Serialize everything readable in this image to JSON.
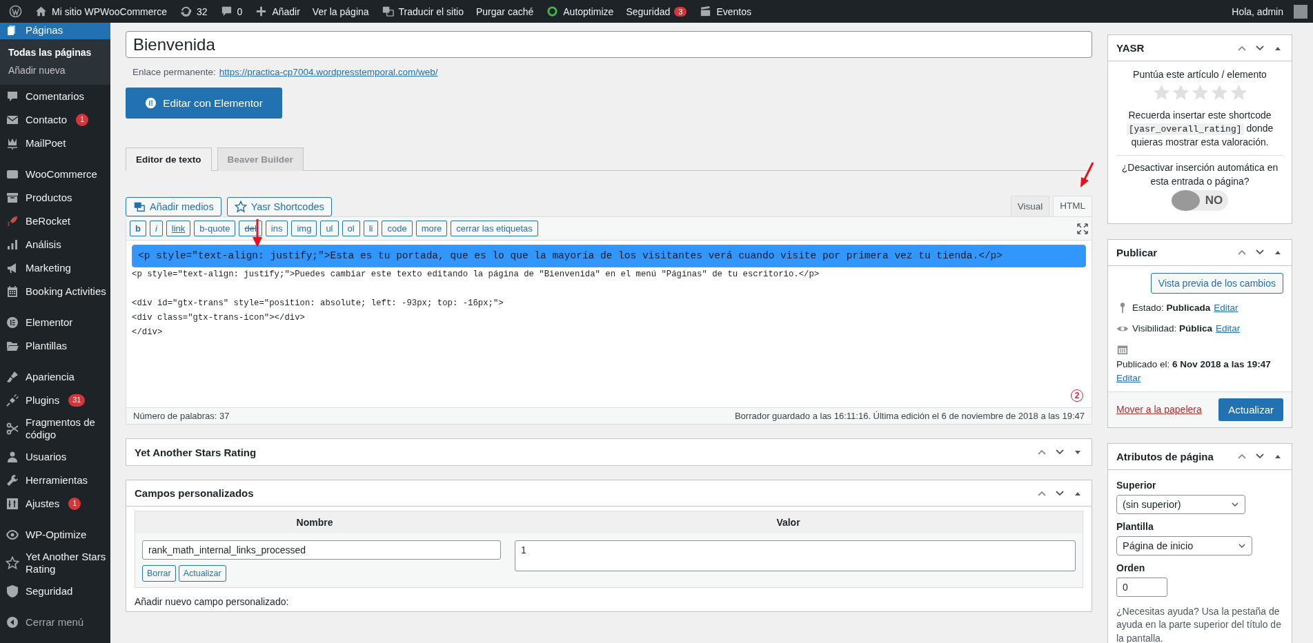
{
  "admin_bar": {
    "items": [
      {
        "label": "Mi sitio WPWooCommerce"
      },
      {
        "label": "32"
      },
      {
        "label": "0"
      },
      {
        "label": "Añadir"
      },
      {
        "label": "Ver la página"
      },
      {
        "label": "Traducir el sitio"
      },
      {
        "label": "Purgar caché"
      },
      {
        "label": "Autoptimize"
      },
      {
        "label": "Seguridad",
        "badge": "3"
      },
      {
        "label": "Eventos"
      }
    ],
    "greeting": "Hola, admin"
  },
  "sidebar": {
    "groups": [
      [
        {
          "label": "Páginas",
          "selected": true,
          "submenu": [
            {
              "label": "Todas las páginas",
              "selected": true
            },
            {
              "label": "Añadir nueva",
              "selected": false
            }
          ]
        },
        {
          "label": "Comentarios",
          "selected": false
        },
        {
          "label": "Contacto",
          "selected": false,
          "badge": "1"
        },
        {
          "label": "MailPoet",
          "selected": false
        }
      ],
      [
        {
          "label": "WooCommerce",
          "selected": false
        },
        {
          "label": "Productos",
          "selected": false
        },
        {
          "label": "BeRocket",
          "selected": false
        },
        {
          "label": "Análisis",
          "selected": false
        },
        {
          "label": "Marketing",
          "selected": false
        },
        {
          "label": "Booking Activities",
          "selected": false
        }
      ],
      [
        {
          "label": "Elementor",
          "selected": false
        },
        {
          "label": "Plantillas",
          "selected": false
        }
      ],
      [
        {
          "label": "Apariencia",
          "selected": false
        },
        {
          "label": "Plugins",
          "selected": false,
          "badge": "31"
        },
        {
          "label": "Fragmentos de código",
          "selected": false
        },
        {
          "label": "Usuarios",
          "selected": false
        },
        {
          "label": "Herramientas",
          "selected": false
        },
        {
          "label": "Ajustes",
          "selected": false,
          "badge": "1"
        }
      ],
      [
        {
          "label": "WP-Optimize",
          "selected": false
        },
        {
          "label": "Yet Another Stars Rating",
          "selected": false
        },
        {
          "label": "Seguridad",
          "selected": false
        }
      ]
    ],
    "collapse_label": "Cerrar menú"
  },
  "editor": {
    "title": "Bienvenida",
    "permalink_label": "Enlace permanente:",
    "permalink_url": "https://practica-cp7004.wordpresstemporal.com/web/",
    "elementor_button": "Editar con Elementor",
    "builder_tabs": [
      {
        "label": "Editor de texto",
        "selected": true
      },
      {
        "label": "Beaver Builder",
        "selected": false
      }
    ],
    "media_buttons": [
      "Añadir medios",
      "Yasr Shortcodes"
    ],
    "mode_tabs": [
      {
        "label": "Visual",
        "selected": false
      },
      {
        "label": "HTML",
        "selected": true
      }
    ],
    "quicktags": [
      "b",
      "i",
      "link",
      "b-quote",
      "del",
      "ins",
      "img",
      "ul",
      "ol",
      "li",
      "code",
      "more",
      "cerrar las etiquetas"
    ],
    "code_paragraphs": [
      [
        {
          "text": "<p style=\"text-align: justify;\">Esta es tu portada, que es lo que la mayoría de los visitantes verá cuando visite por primera vez tu tienda.</p>",
          "selected": true
        },
        {
          "text": "<p style=\"text-align: justify;\">Puedes cambiar este texto editando la página de \"Bienvenida\" en el menú \"Páginas\" de tu escritorio.</p>",
          "selected": false
        }
      ],
      [
        {
          "text": "<div id=\"gtx-trans\" style=\"position: absolute; left: -93px; top: -16px;\">",
          "selected": false
        },
        {
          "text": "<div class=\"gtx-trans-icon\"></div>",
          "selected": false
        },
        {
          "text": "</div>",
          "selected": false
        }
      ]
    ],
    "annotation_label": "2",
    "word_count": "Número de palabras: 37",
    "autosave": "Borrador guardado a las 16:11:16. Última edición el 6 de noviembre de 2018 a las 19:47"
  },
  "metaboxes": [
    {
      "title": "Yet Another Stars Rating",
      "expanded": false
    },
    {
      "title": "Campos personalizados",
      "expanded": true,
      "columns": [
        "Nombre",
        "Valor"
      ],
      "field_name": "rank_math_internal_links_processed",
      "field_value": "1",
      "buttons": [
        "Borrar",
        "Actualizar"
      ],
      "add_new": "Añadir nuevo campo personalizado:"
    }
  ],
  "yasr": {
    "title": "YASR",
    "expanded": true,
    "rate_text": "Puntúa este artículo / elemento",
    "stars": 0,
    "reminder_before": "Recuerda insertar este shortcode",
    "shortcode": "[yasr_overall_rating]",
    "reminder_after": "donde quieras mostrar esta valoración.",
    "question": "¿Desactivar inserción automática en esta entrada o página?",
    "toggle": {
      "label": "NO",
      "on": false
    }
  },
  "publish": {
    "title": "Publicar",
    "expanded": true,
    "preview_button": "Vista previa de los cambios",
    "rows": [
      {
        "label": "Estado:",
        "value": "Publicada",
        "link": "Editar"
      },
      {
        "label": "Visibilidad:",
        "value": "Pública",
        "link": "Editar"
      },
      {
        "label": "Publicado el:",
        "value": "6 Nov 2018 a las 19:47",
        "link": "Editar"
      }
    ],
    "trash": "Mover a la papelera",
    "update": "Actualizar"
  },
  "page_attributes": {
    "title": "Atributos de página",
    "expanded": true,
    "parent_label": "Superior",
    "parent_value": "(sin superior)",
    "template_label": "Plantilla",
    "template_value": "Página de inicio",
    "order_label": "Orden",
    "order_value": "0",
    "help": "¿Necesitas ayuda? Usa la pestaña de ayuda en la parte superior del título de la pantalla."
  }
}
